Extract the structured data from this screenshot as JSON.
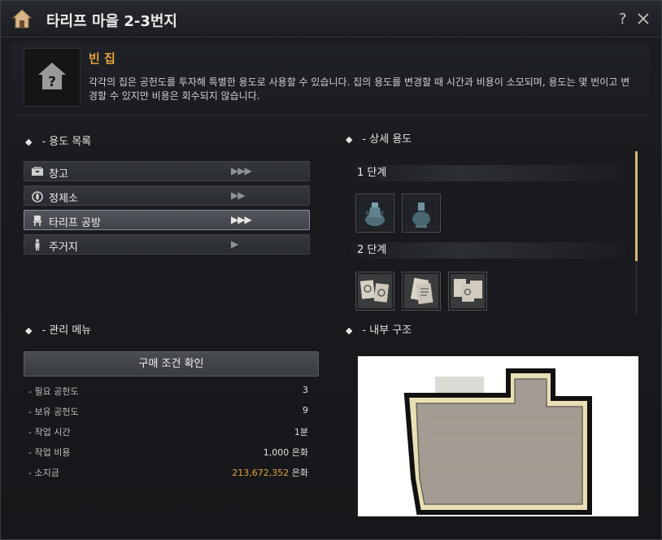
{
  "window": {
    "title": "타리프 마을 2-3번지",
    "help_label": "?"
  },
  "house": {
    "title": "빈 집",
    "description": "각각의 집은 공헌도를 투자해 특별한 용도로 사용할 수 있습니다. 집의 용도를 변경할 때 시간과 비용이 소모되며, 용도는 몇 번이고 변경할 수 있지만 비용은 회수되지 않습니다."
  },
  "usage_list": {
    "title": "- 용도 목록",
    "items": [
      {
        "label": "창고",
        "arrows": "▶▶▶",
        "icon": "storage-icon"
      },
      {
        "label": "정제소",
        "arrows": "▶▶",
        "icon": "refinery-icon"
      },
      {
        "label": "타리프 공방",
        "arrows": "▶▶▶",
        "icon": "workshop-icon",
        "selected": true
      },
      {
        "label": "주거지",
        "arrows": "▶",
        "icon": "residence-icon"
      }
    ]
  },
  "detail": {
    "title": "- 상세 용도",
    "stages": [
      {
        "label": "1 단계",
        "items": [
          "vase-item-icon",
          "vase-item-icon"
        ]
      },
      {
        "label": "2 단계",
        "items": [
          "paper-item-icon",
          "paper-item-icon",
          "paper-item-icon"
        ]
      }
    ]
  },
  "management": {
    "title": "- 관리 메뉴",
    "confirm_button": "구매 조건 확인",
    "stats": [
      {
        "label": "- 필요 공헌도",
        "value": "3",
        "unit": ""
      },
      {
        "label": "- 보유 공헌도",
        "value": "9",
        "unit": ""
      },
      {
        "label": "- 작업 시간",
        "value": "1분",
        "unit": ""
      },
      {
        "label": "- 작업 비용",
        "value": "1,000",
        "unit": " 은화"
      },
      {
        "label": "- 소지금",
        "value": "213,672,352",
        "unit": " 은화",
        "highlight": true
      }
    ]
  },
  "interior": {
    "title": "- 내부 구조"
  },
  "colors": {
    "accent": "#e8a43a",
    "panel": "#1b1d21",
    "selected_border": "#8c9097"
  }
}
